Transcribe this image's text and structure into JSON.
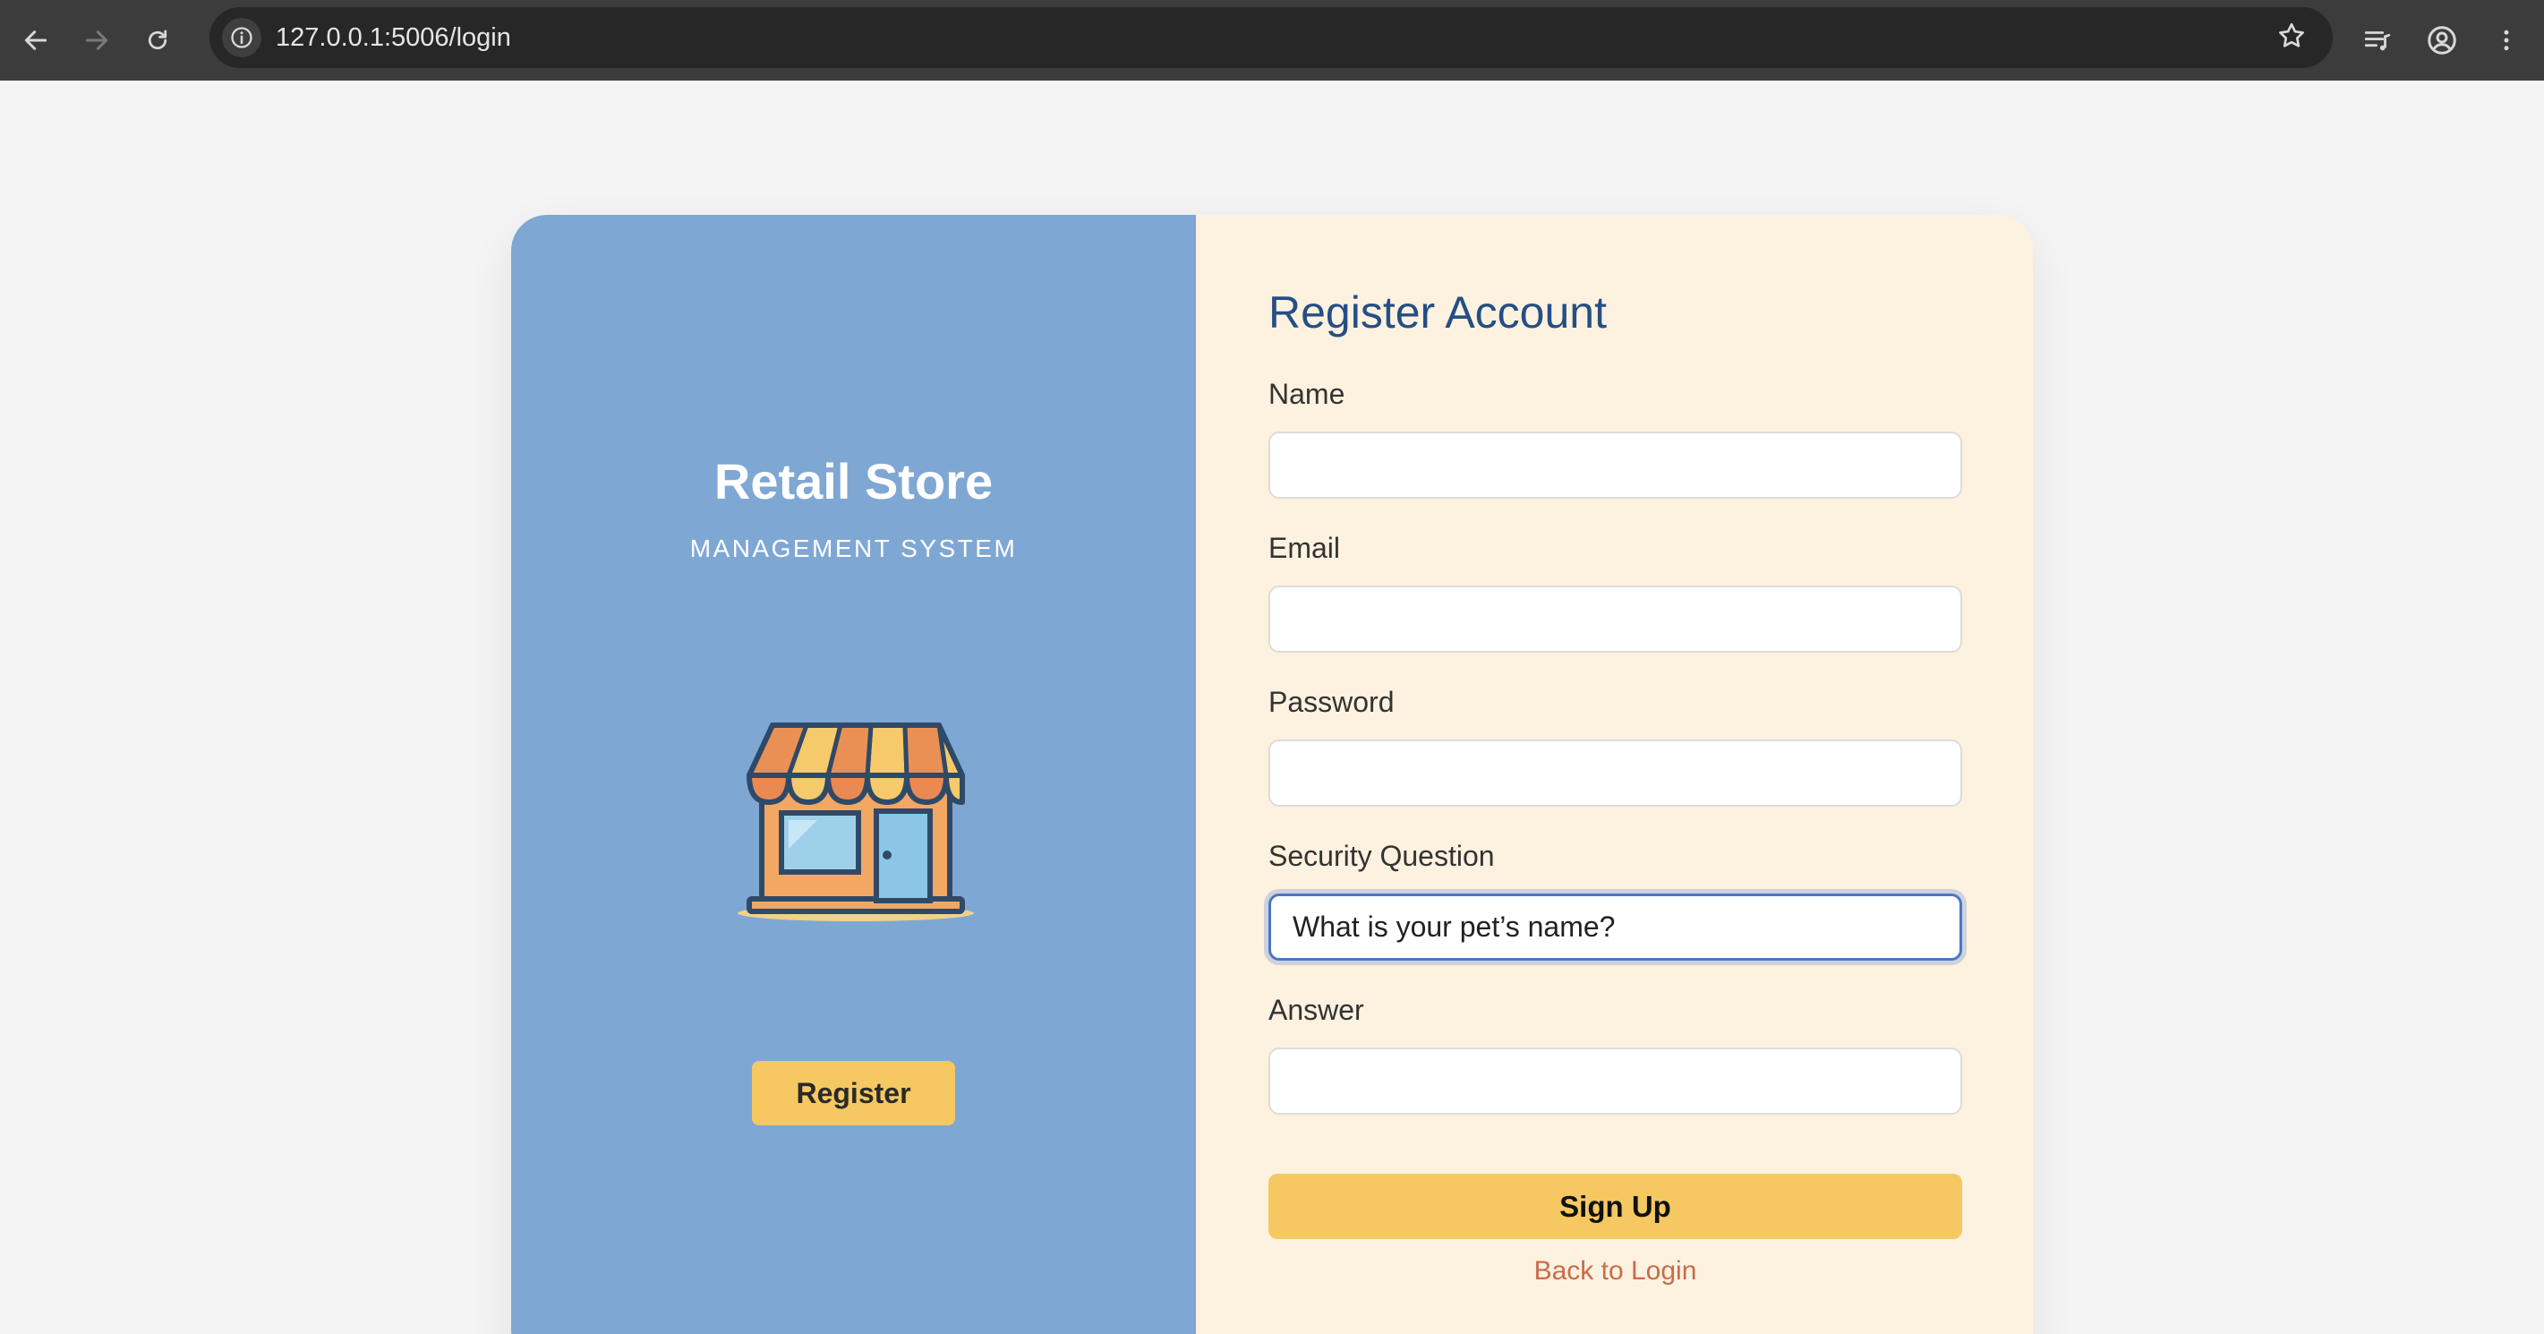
{
  "browser": {
    "url": "127.0.0.1:5006/login"
  },
  "brand": {
    "title": "Retail Store",
    "subtitle": "MANAGEMENT SYSTEM",
    "register_label": "Register"
  },
  "form": {
    "heading": "Register Account",
    "fields": [
      {
        "label": "Name",
        "value": ""
      },
      {
        "label": "Email",
        "value": ""
      },
      {
        "label": "Password",
        "value": ""
      },
      {
        "label": "Security Question",
        "value": "What is your pet’s name?"
      },
      {
        "label": "Answer",
        "value": ""
      }
    ],
    "submit_label": "Sign Up",
    "back_link": "Back to Login"
  },
  "colors": {
    "left_panel": "#7fa7d4",
    "right_panel": "#fdf2df",
    "accent_button": "#f5c862",
    "heading": "#254e85",
    "link": "#c96b4b"
  }
}
